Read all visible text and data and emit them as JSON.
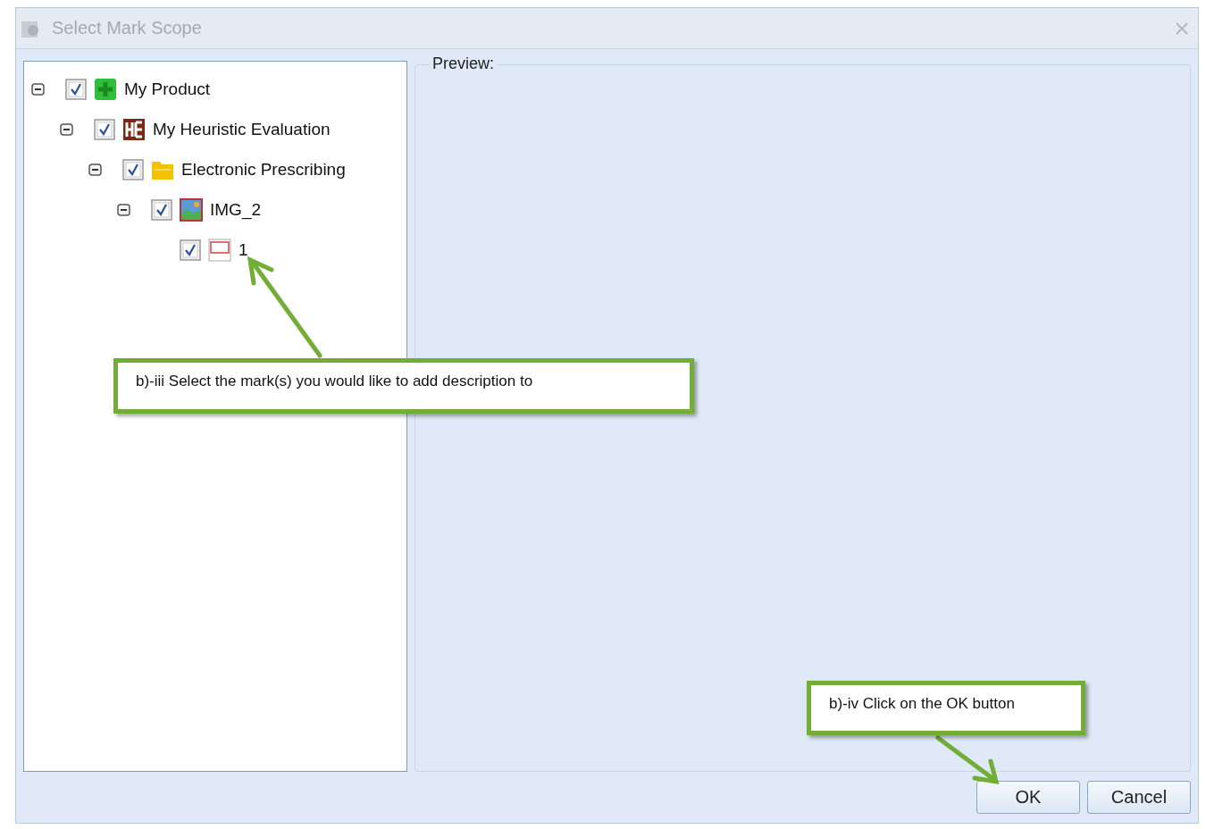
{
  "window": {
    "title": "Select Mark Scope"
  },
  "tree": [
    {
      "label": "My Product",
      "kind": "product",
      "checked": true,
      "expanded": true,
      "children": [
        {
          "label": "My Heuristic Evaluation",
          "kind": "evaluation",
          "checked": true,
          "expanded": true,
          "children": [
            {
              "label": "Electronic Prescribing",
              "kind": "folder",
              "checked": true,
              "expanded": true,
              "children": [
                {
                  "label": "IMG_2",
                  "kind": "image",
                  "checked": true,
                  "expanded": true,
                  "children": [
                    {
                      "label": "1",
                      "kind": "mark",
                      "checked": true
                    }
                  ]
                }
              ]
            }
          ]
        }
      ]
    }
  ],
  "preview": {
    "label": "Preview:"
  },
  "buttons": [
    "OK",
    "Cancel"
  ],
  "callouts": [
    {
      "text": "b)-iii Select the mark(s) you would like to add description to"
    },
    {
      "text": "b)-iv Click on the OK button"
    }
  ]
}
